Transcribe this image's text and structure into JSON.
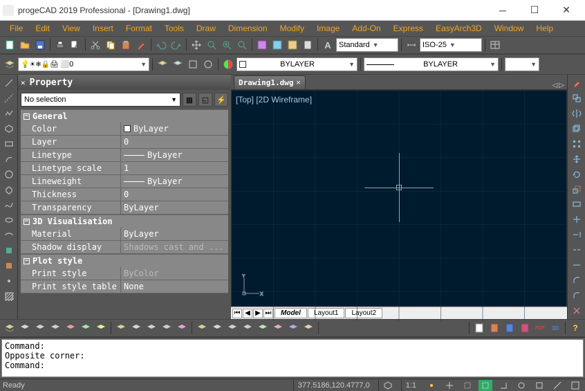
{
  "window": {
    "title": "progeCAD 2019 Professional - [Drawing1.dwg]",
    "min_label": "─",
    "max_label": "☐",
    "close_label": "✕"
  },
  "menu": [
    "File",
    "Edit",
    "View",
    "Insert",
    "Format",
    "Tools",
    "Draw",
    "Dimension",
    "Modify",
    "Image",
    "Add-On",
    "Express",
    "EasyArch3D",
    "Window",
    "Help"
  ],
  "toolbars": {
    "text_style": "Standard",
    "dim_style": "ISO-25",
    "layer_current": "0",
    "color_label": "BYLAYER",
    "linetype_label": "BYLAYER"
  },
  "property_panel": {
    "title": "Property",
    "selection": "No selection",
    "categories": [
      {
        "name": "General",
        "rows": [
          {
            "key": "Color",
            "value": "ByLayer",
            "swatch": true
          },
          {
            "key": "Layer",
            "value": "0"
          },
          {
            "key": "Linetype",
            "value": "ByLayer",
            "line": true
          },
          {
            "key": "Linetype scale",
            "value": "1"
          },
          {
            "key": "Lineweight",
            "value": "ByLayer",
            "line": true
          },
          {
            "key": "Thickness",
            "value": "0"
          },
          {
            "key": "Transparency",
            "value": "ByLayer"
          }
        ]
      },
      {
        "name": "3D Visualisation",
        "rows": [
          {
            "key": "Material",
            "value": "ByLayer"
          },
          {
            "key": "Shadow display",
            "value": "Shadows cast and ...",
            "dim": true
          }
        ]
      },
      {
        "name": "Plot style",
        "rows": [
          {
            "key": "Print style",
            "value": "ByColor",
            "dim": true
          },
          {
            "key": "Print style table",
            "value": "None"
          }
        ]
      }
    ]
  },
  "document": {
    "tab_name": "Drawing1.dwg",
    "view_label": "[Top] [2D Wireframe]",
    "ucs_labels": {
      "x": "X",
      "y": "Y"
    },
    "layout_tabs": [
      "Model",
      "Layout1",
      "Layout2"
    ]
  },
  "command": {
    "lines": [
      "Command:",
      "Opposite corner:",
      "Command:"
    ]
  },
  "statusbar": {
    "ready": "Ready",
    "coords": "377.5186,120.4777,0",
    "ratio": "1:1"
  }
}
